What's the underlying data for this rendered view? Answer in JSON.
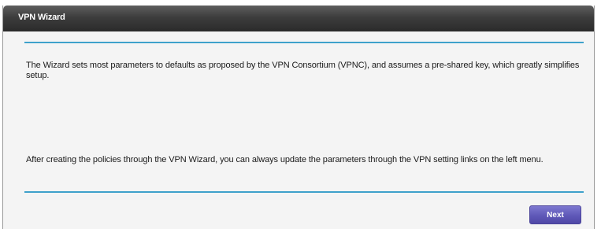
{
  "window": {
    "title": "VPN Wizard"
  },
  "content": {
    "paragraph_1": "The Wizard sets most parameters to defaults as proposed by the VPN Consortium (VPNC), and assumes a pre-shared key, which greatly simplifies setup.",
    "paragraph_2": "After creating the policies through the VPN Wizard, you can always update the parameters through the VPN setting links on the left menu."
  },
  "actions": {
    "next_label": "Next"
  },
  "colors": {
    "title_bar": "#3d3d3d",
    "divider": "#3ea1cb",
    "next_button": "#5f58b8",
    "panel_background": "#f4f4f4"
  }
}
